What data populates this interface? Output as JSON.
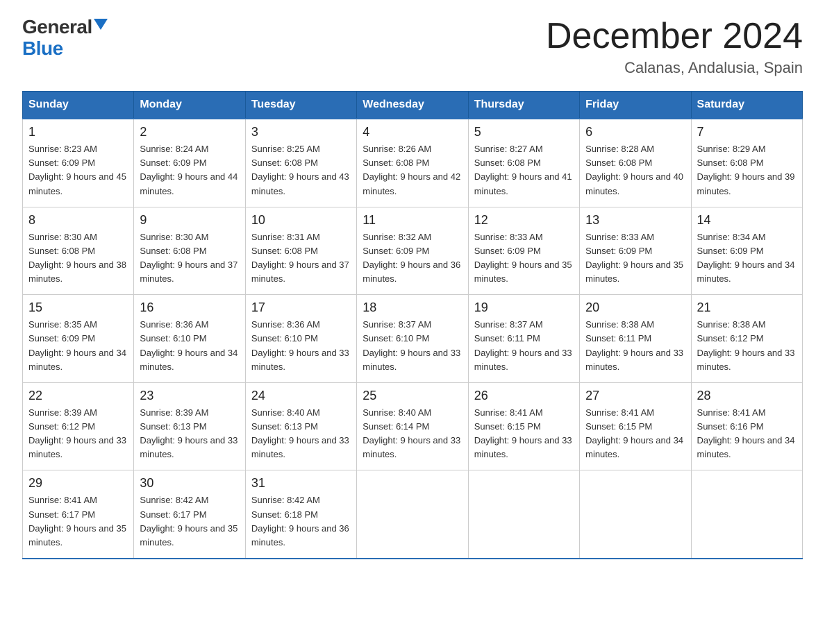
{
  "header": {
    "logo_general": "General",
    "logo_blue": "Blue",
    "month_title": "December 2024",
    "location": "Calanas, Andalusia, Spain"
  },
  "days_of_week": [
    "Sunday",
    "Monday",
    "Tuesday",
    "Wednesday",
    "Thursday",
    "Friday",
    "Saturday"
  ],
  "weeks": [
    [
      {
        "day": "1",
        "sunrise": "8:23 AM",
        "sunset": "6:09 PM",
        "daylight": "9 hours and 45 minutes."
      },
      {
        "day": "2",
        "sunrise": "8:24 AM",
        "sunset": "6:09 PM",
        "daylight": "9 hours and 44 minutes."
      },
      {
        "day": "3",
        "sunrise": "8:25 AM",
        "sunset": "6:08 PM",
        "daylight": "9 hours and 43 minutes."
      },
      {
        "day": "4",
        "sunrise": "8:26 AM",
        "sunset": "6:08 PM",
        "daylight": "9 hours and 42 minutes."
      },
      {
        "day": "5",
        "sunrise": "8:27 AM",
        "sunset": "6:08 PM",
        "daylight": "9 hours and 41 minutes."
      },
      {
        "day": "6",
        "sunrise": "8:28 AM",
        "sunset": "6:08 PM",
        "daylight": "9 hours and 40 minutes."
      },
      {
        "day": "7",
        "sunrise": "8:29 AM",
        "sunset": "6:08 PM",
        "daylight": "9 hours and 39 minutes."
      }
    ],
    [
      {
        "day": "8",
        "sunrise": "8:30 AM",
        "sunset": "6:08 PM",
        "daylight": "9 hours and 38 minutes."
      },
      {
        "day": "9",
        "sunrise": "8:30 AM",
        "sunset": "6:08 PM",
        "daylight": "9 hours and 37 minutes."
      },
      {
        "day": "10",
        "sunrise": "8:31 AM",
        "sunset": "6:08 PM",
        "daylight": "9 hours and 37 minutes."
      },
      {
        "day": "11",
        "sunrise": "8:32 AM",
        "sunset": "6:09 PM",
        "daylight": "9 hours and 36 minutes."
      },
      {
        "day": "12",
        "sunrise": "8:33 AM",
        "sunset": "6:09 PM",
        "daylight": "9 hours and 35 minutes."
      },
      {
        "day": "13",
        "sunrise": "8:33 AM",
        "sunset": "6:09 PM",
        "daylight": "9 hours and 35 minutes."
      },
      {
        "day": "14",
        "sunrise": "8:34 AM",
        "sunset": "6:09 PM",
        "daylight": "9 hours and 34 minutes."
      }
    ],
    [
      {
        "day": "15",
        "sunrise": "8:35 AM",
        "sunset": "6:09 PM",
        "daylight": "9 hours and 34 minutes."
      },
      {
        "day": "16",
        "sunrise": "8:36 AM",
        "sunset": "6:10 PM",
        "daylight": "9 hours and 34 minutes."
      },
      {
        "day": "17",
        "sunrise": "8:36 AM",
        "sunset": "6:10 PM",
        "daylight": "9 hours and 33 minutes."
      },
      {
        "day": "18",
        "sunrise": "8:37 AM",
        "sunset": "6:10 PM",
        "daylight": "9 hours and 33 minutes."
      },
      {
        "day": "19",
        "sunrise": "8:37 AM",
        "sunset": "6:11 PM",
        "daylight": "9 hours and 33 minutes."
      },
      {
        "day": "20",
        "sunrise": "8:38 AM",
        "sunset": "6:11 PM",
        "daylight": "9 hours and 33 minutes."
      },
      {
        "day": "21",
        "sunrise": "8:38 AM",
        "sunset": "6:12 PM",
        "daylight": "9 hours and 33 minutes."
      }
    ],
    [
      {
        "day": "22",
        "sunrise": "8:39 AM",
        "sunset": "6:12 PM",
        "daylight": "9 hours and 33 minutes."
      },
      {
        "day": "23",
        "sunrise": "8:39 AM",
        "sunset": "6:13 PM",
        "daylight": "9 hours and 33 minutes."
      },
      {
        "day": "24",
        "sunrise": "8:40 AM",
        "sunset": "6:13 PM",
        "daylight": "9 hours and 33 minutes."
      },
      {
        "day": "25",
        "sunrise": "8:40 AM",
        "sunset": "6:14 PM",
        "daylight": "9 hours and 33 minutes."
      },
      {
        "day": "26",
        "sunrise": "8:41 AM",
        "sunset": "6:15 PM",
        "daylight": "9 hours and 33 minutes."
      },
      {
        "day": "27",
        "sunrise": "8:41 AM",
        "sunset": "6:15 PM",
        "daylight": "9 hours and 34 minutes."
      },
      {
        "day": "28",
        "sunrise": "8:41 AM",
        "sunset": "6:16 PM",
        "daylight": "9 hours and 34 minutes."
      }
    ],
    [
      {
        "day": "29",
        "sunrise": "8:41 AM",
        "sunset": "6:17 PM",
        "daylight": "9 hours and 35 minutes."
      },
      {
        "day": "30",
        "sunrise": "8:42 AM",
        "sunset": "6:17 PM",
        "daylight": "9 hours and 35 minutes."
      },
      {
        "day": "31",
        "sunrise": "8:42 AM",
        "sunset": "6:18 PM",
        "daylight": "9 hours and 36 minutes."
      },
      null,
      null,
      null,
      null
    ]
  ]
}
